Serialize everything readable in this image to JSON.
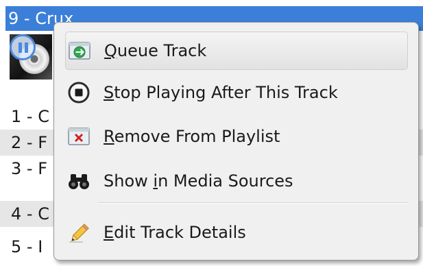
{
  "playlist": {
    "current_track": "9 - Crux",
    "tracks": [
      {
        "label": "1 - C"
      },
      {
        "label": "2 - F"
      },
      {
        "label": "3 - F"
      },
      {
        "label": "4 - C"
      },
      {
        "label": "5 - I"
      }
    ]
  },
  "context_menu": {
    "items": [
      {
        "label_accel": "Q",
        "label_rest": "ueue Track",
        "icon": "queue-track-icon",
        "highlighted": true
      },
      {
        "label_accel": "S",
        "label_rest": "top Playing After This Track",
        "icon": "stop-icon"
      },
      {
        "label_accel": "R",
        "label_rest": "emove From Playlist",
        "icon": "remove-from-playlist-icon"
      },
      {
        "label_pre": "Show ",
        "label_accel": "i",
        "label_rest": "n Media Sources",
        "icon": "binoculars-icon"
      },
      {
        "label_accel": "E",
        "label_rest": "dit Track Details",
        "icon": "pencil-icon"
      }
    ]
  },
  "colors": {
    "selection_blue": "#3b7fd9",
    "menu_background": "#f0f0f0",
    "highlight_border": "#cfcfcf"
  }
}
